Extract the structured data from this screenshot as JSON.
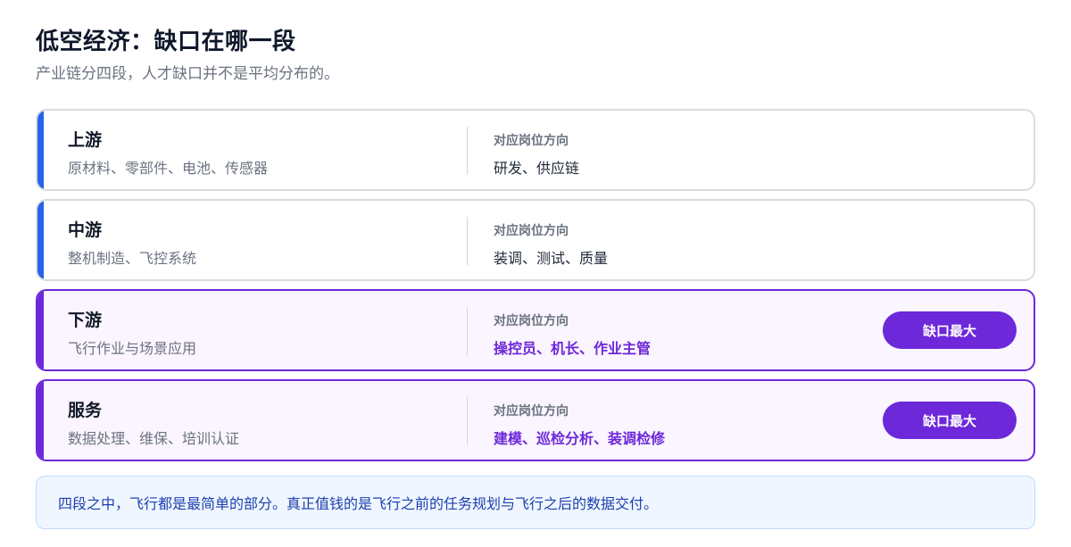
{
  "header": {
    "title": "低空经济：缺口在哪一段",
    "subtitle": "产业链分四段，人才缺口并不是平均分布的。"
  },
  "segments": [
    {
      "name": "上游",
      "desc": "原材料、零部件、电池、传感器",
      "roles_label": "对应岗位方向",
      "roles": "研发、供应链",
      "highlight": false,
      "badge": ""
    },
    {
      "name": "中游",
      "desc": "整机制造、飞控系统",
      "roles_label": "对应岗位方向",
      "roles": "装调、测试、质量",
      "highlight": false,
      "badge": ""
    },
    {
      "name": "下游",
      "desc": "飞行作业与场景应用",
      "roles_label": "对应岗位方向",
      "roles": "操控员、机长、作业主管",
      "highlight": true,
      "badge": "缺口最大"
    },
    {
      "name": "服务",
      "desc": "数据处理、维保、培训认证",
      "roles_label": "对应岗位方向",
      "roles": "建模、巡检分析、装调检修",
      "highlight": true,
      "badge": "缺口最大"
    }
  ],
  "note": "四段之中，飞行都是最简单的部分。真正值钱的是飞行之前的任务规划与飞行之后的数据交付。",
  "colors": {
    "accent_blue": "#2563eb",
    "accent_purple": "#6d28d9",
    "note_bg": "#eff6ff"
  }
}
